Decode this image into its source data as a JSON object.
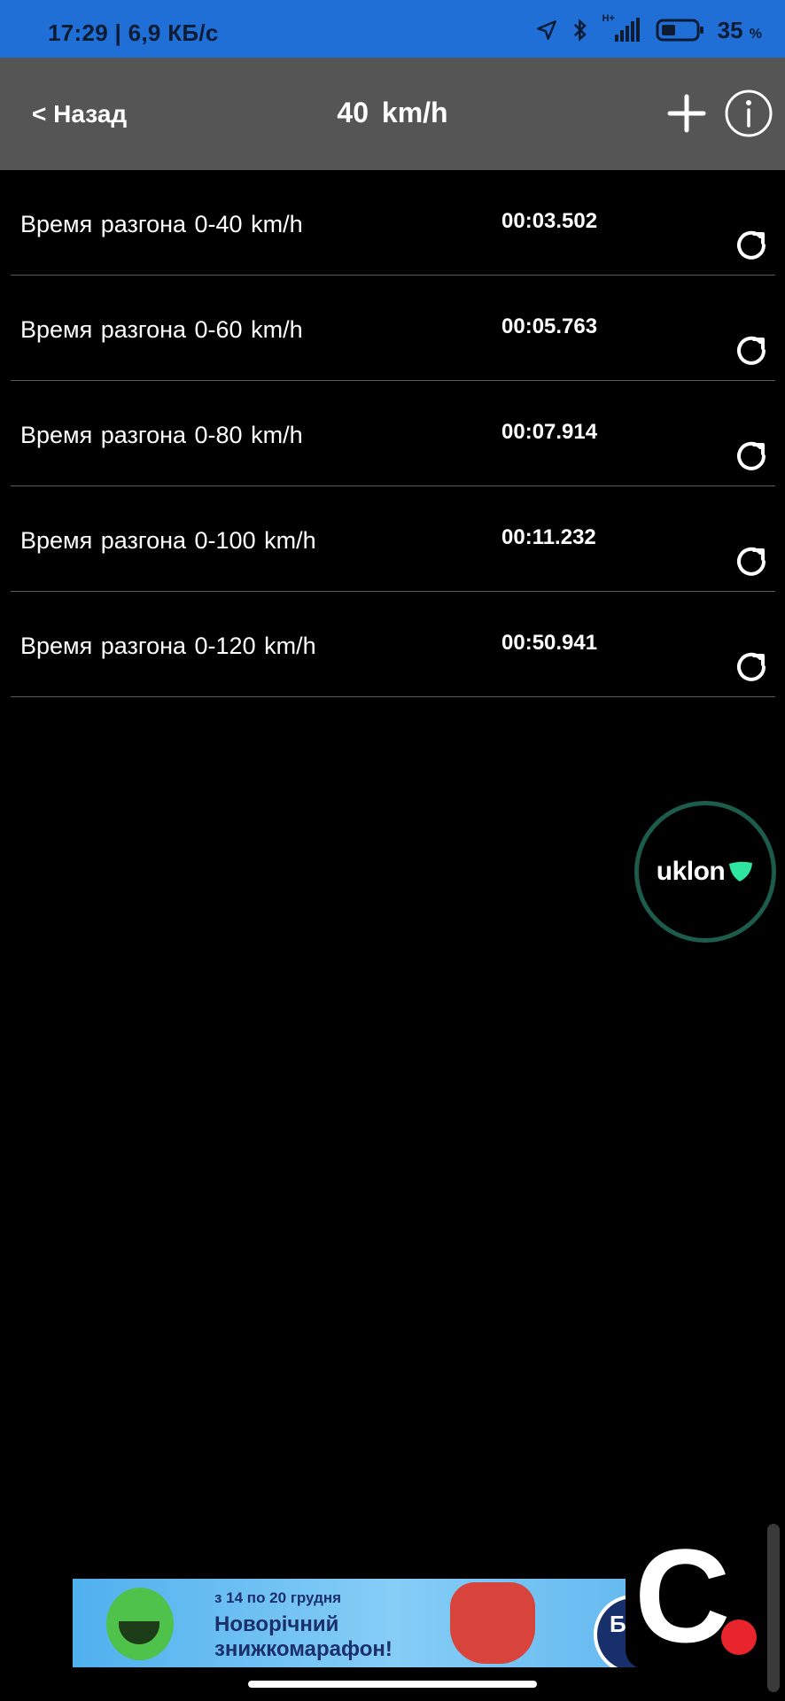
{
  "status_bar": {
    "time": "17:29",
    "network_speed": "6,9 КБ/с",
    "network_type": "H+",
    "battery_percent": "35",
    "battery_unit": "%",
    "background_color": "#1f6fd6"
  },
  "nav": {
    "back_label": "< Назад",
    "title": "40  km/h",
    "add_icon": "plus-icon",
    "info_icon": "info-icon",
    "background_color": "#555555"
  },
  "results": [
    {
      "label": "Время разгона  0-40 km/h",
      "time": "00:03.502"
    },
    {
      "label": "Время разгона  0-60 km/h",
      "time": "00:05.763"
    },
    {
      "label": "Время разгона  0-80 km/h",
      "time": "00:07.914"
    },
    {
      "label": "Время разгона  0-100 km/h",
      "time": "00:11.232"
    },
    {
      "label": "Время разгона  0-120 km/h",
      "time": "00:50.941"
    }
  ],
  "floating_badge": {
    "text": "uklon",
    "ring_color": "#1d5b4a",
    "accent_color": "#2ee6a0"
  },
  "ad_banner": {
    "date_text": "з 14 по 20 грудня",
    "headline": "Новорічний знижкомарафон!",
    "circle_text": "Б з"
  },
  "app_logo": {
    "letter": "C",
    "dot_color": "#e8242d"
  }
}
